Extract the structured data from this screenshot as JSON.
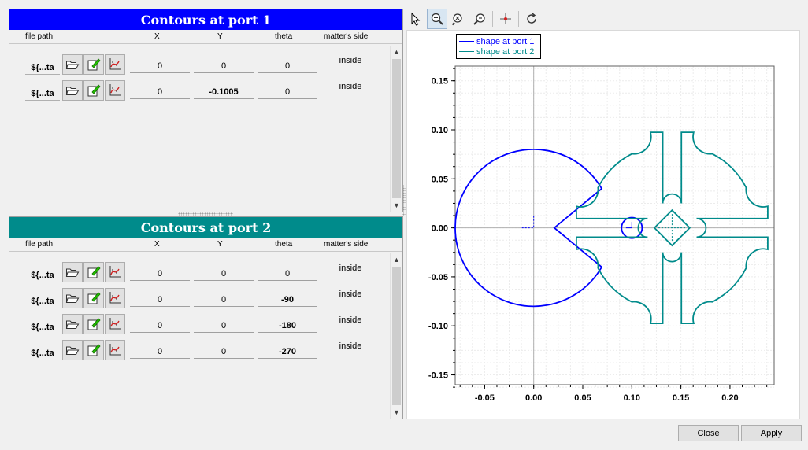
{
  "colors": {
    "port1": "#0000ff",
    "port2": "#008b8b"
  },
  "headers": {
    "file_path": "file path",
    "x": "X",
    "y": "Y",
    "theta": "theta",
    "side": "matter's side"
  },
  "port1": {
    "title": "Contours at port 1",
    "rows": [
      {
        "path": "${...ta",
        "x": "0",
        "y": "0",
        "theta": "0",
        "side": "inside"
      },
      {
        "path": "${...ta",
        "x": "0",
        "y": "-0.1005",
        "theta": "0",
        "side": "inside"
      }
    ]
  },
  "port2": {
    "title": "Contours at port 2",
    "rows": [
      {
        "path": "${...ta",
        "x": "0",
        "y": "0",
        "theta": "0",
        "side": "inside"
      },
      {
        "path": "${...ta",
        "x": "0",
        "y": "0",
        "theta": "-90",
        "side": "inside"
      },
      {
        "path": "${...ta",
        "x": "0",
        "y": "0",
        "theta": "-180",
        "side": "inside"
      },
      {
        "path": "${...ta",
        "x": "0",
        "y": "0",
        "theta": "-270",
        "side": "inside"
      }
    ]
  },
  "toolbar": [
    "select-arrow-icon",
    "zoom-region-icon",
    "zoom-out-icon",
    "zoom-in-icon",
    "crosshair-icon",
    "reset-view-icon"
  ],
  "chart_data": {
    "type": "line",
    "xlim": [
      -0.08,
      0.245
    ],
    "ylim": [
      -0.16,
      0.165
    ],
    "x_ticks": [
      "-0.05",
      "0.00",
      "0.05",
      "0.10",
      "0.15",
      "0.20"
    ],
    "y_ticks": [
      "0.15",
      "0.10",
      "0.05",
      "0.00",
      "-0.05",
      "-0.10",
      "-0.15"
    ],
    "grid": true,
    "legend_position": "top-left",
    "series": [
      {
        "name": "shape at port 1",
        "color": "#0000ff"
      },
      {
        "name": "shape at port 2",
        "color": "#008b8b"
      }
    ]
  },
  "buttons": {
    "close": "Close",
    "apply": "Apply"
  }
}
